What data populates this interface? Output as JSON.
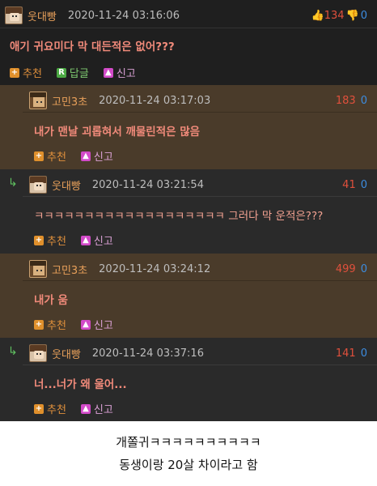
{
  "comments": [
    {
      "nick": "웃대빵",
      "date": "2020-11-24 03:16:06",
      "text": "애기 귀요미다 막 대든적은 없어???",
      "up": "134",
      "down": "0",
      "actions": {
        "recommend": "추천",
        "reply": "답글",
        "report": "신고"
      }
    },
    {
      "nick": "고민3초",
      "date": "2020-11-24 03:17:03",
      "score": "183",
      "score_down": "0",
      "text": "내가 맨날 괴롭혀서 깨물린적은 많음",
      "actions": {
        "recommend": "추천",
        "report": "신고"
      }
    },
    {
      "nick": "웃대빵",
      "date": "2020-11-24 03:21:54",
      "score": "41",
      "score_down": "0",
      "text": "ㅋㅋㅋㅋㅋㅋㅋㅋㅋㅋㅋㅋㅋㅋㅋㅋㅋㅋㅋ 그러다 막 운적은???",
      "actions": {
        "recommend": "추천",
        "report": "신고"
      }
    },
    {
      "nick": "고민3초",
      "date": "2020-11-24 03:24:12",
      "score": "499",
      "score_down": "0",
      "text": "내가 움",
      "actions": {
        "recommend": "추천",
        "report": "신고"
      }
    },
    {
      "nick": "웃대빵",
      "date": "2020-11-24 03:37:16",
      "score": "141",
      "score_down": "0",
      "text": "너...너가 왜 울어...",
      "actions": {
        "recommend": "추천",
        "report": "신고"
      }
    }
  ],
  "caption": {
    "line1": "개쫄귀ㅋㅋㅋㅋㅋㅋㅋㅋㅋㅋ",
    "line2": "동생이랑 20살 차이라고 함"
  },
  "colors": {
    "nick": "#e8a05a",
    "text": "#f08a7a",
    "score_red": "#e0503c",
    "score_blue": "#3c8ce0",
    "reply_arrow": "#5fc060"
  },
  "icons": [
    "thumbs-up-icon",
    "thumbs-down-icon",
    "plus-icon",
    "reply-icon",
    "report-icon",
    "reply-arrow-icon"
  ]
}
